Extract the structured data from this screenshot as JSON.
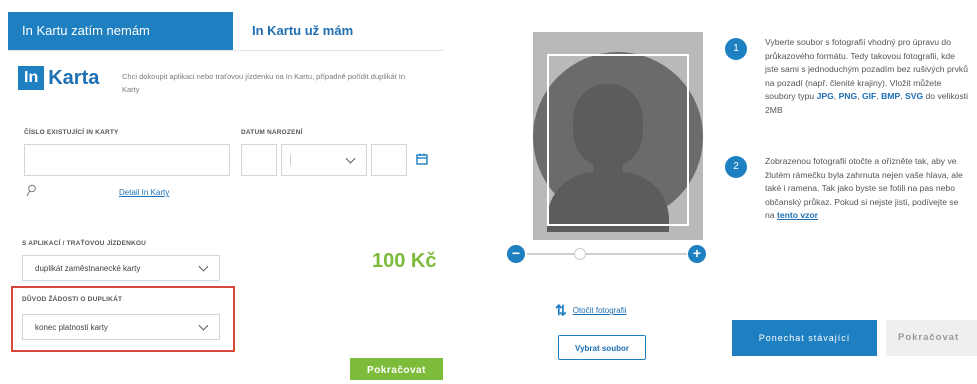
{
  "tabs": {
    "active": "In Kartu zatím nemám",
    "other": "In Kartu už mám"
  },
  "logo": {
    "in": "In",
    "karta": "Karta"
  },
  "intro_text": "Chci dokoupit aplikaci nebo traťovou jízdenku na In Kartu, případně pořídit duplikát In Karty",
  "card_number": {
    "label": "ČÍSLO EXISTUJÍCÍ IN KARTY",
    "value": ""
  },
  "birth_date": {
    "label": "DATUM NAROZENÍ",
    "day": "",
    "month": "",
    "year": ""
  },
  "detail_link": "Detail In Karty",
  "application": {
    "label": "S APLIKACÍ / TRAŤOVOU JÍZDENKOU",
    "selected": "duplikát zaměstnanecké karty"
  },
  "price": "100 Kč",
  "reason": {
    "label": "DŮVOD ŽÁDOSTI O DUPLIKÁT",
    "selected": "konec platnosti karty"
  },
  "continue_label": "Pokračovat",
  "zoom": {
    "minus": "−",
    "plus": "+",
    "level": 0.3
  },
  "rotate": {
    "icon": "rotate-arrows-icon",
    "label": "Otočit fotografii"
  },
  "choose_file_label": "Vybrat soubor",
  "steps": [
    {
      "number": "1",
      "text_before": "Vyberte soubor s fotografií vhodný pro úpravu do průkazového formátu. Tedy takovou fotografii, kde jste sami s jednoduchým pozadím bez rušivých prvků na pozadí (např. členité krajiny). Vložit můžete soubory typu ",
      "types": [
        "JPG",
        "PNG",
        "GIF",
        "BMP",
        "SVG"
      ],
      "text_after": " do velikosti 2MB"
    },
    {
      "number": "2",
      "text": "Zobrazenou fotografii otočte a ořízněte tak, aby ve žlutém rámečku byla zahrnuta nejen vaše hlava, ale také i ramena. Tak jako byste se fotili na pas nebo občanský průkaz. Pokud si nejste jisti, podívejte se na ",
      "link": "tento vzor"
    }
  ],
  "keep_label": "Ponechat stávající",
  "continue_right_label": "Pokračovat",
  "colors": {
    "primary": "#1e7fc1",
    "green": "#7dbb3a",
    "highlight": "#d9463b"
  }
}
